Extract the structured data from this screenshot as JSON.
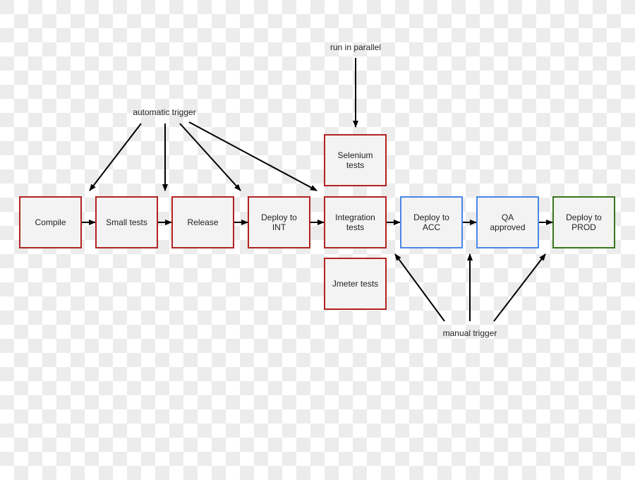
{
  "colors": {
    "build": "#b22222",
    "acc": "#4a86e8",
    "prod": "#38761d",
    "box_fill": "#f3f3f3",
    "arrow": "#000000"
  },
  "nodes": [
    {
      "id": "compile",
      "lines": [
        "Compile"
      ],
      "stage": "build"
    },
    {
      "id": "small-tests",
      "lines": [
        "Small tests"
      ],
      "stage": "build"
    },
    {
      "id": "release",
      "lines": [
        "Release"
      ],
      "stage": "build"
    },
    {
      "id": "deploy-int",
      "lines": [
        "Deploy to",
        "INT"
      ],
      "stage": "build"
    },
    {
      "id": "integration-tests",
      "lines": [
        "Integration",
        "tests"
      ],
      "stage": "build"
    },
    {
      "id": "deploy-acc",
      "lines": [
        "Deploy to",
        "ACC"
      ],
      "stage": "acc"
    },
    {
      "id": "qa-approved",
      "lines": [
        "QA",
        "approved"
      ],
      "stage": "acc"
    },
    {
      "id": "deploy-prod",
      "lines": [
        "Deploy to",
        "PROD"
      ],
      "stage": "prod"
    },
    {
      "id": "selenium-tests",
      "lines": [
        "Selenium",
        "tests"
      ],
      "stage": "build"
    },
    {
      "id": "jmeter-tests",
      "lines": [
        "Jmeter tests"
      ],
      "stage": "build"
    }
  ],
  "annotations": {
    "automatic_trigger": "automatic trigger",
    "run_in_parallel": "run in parallel",
    "manual_trigger": "manual trigger"
  }
}
